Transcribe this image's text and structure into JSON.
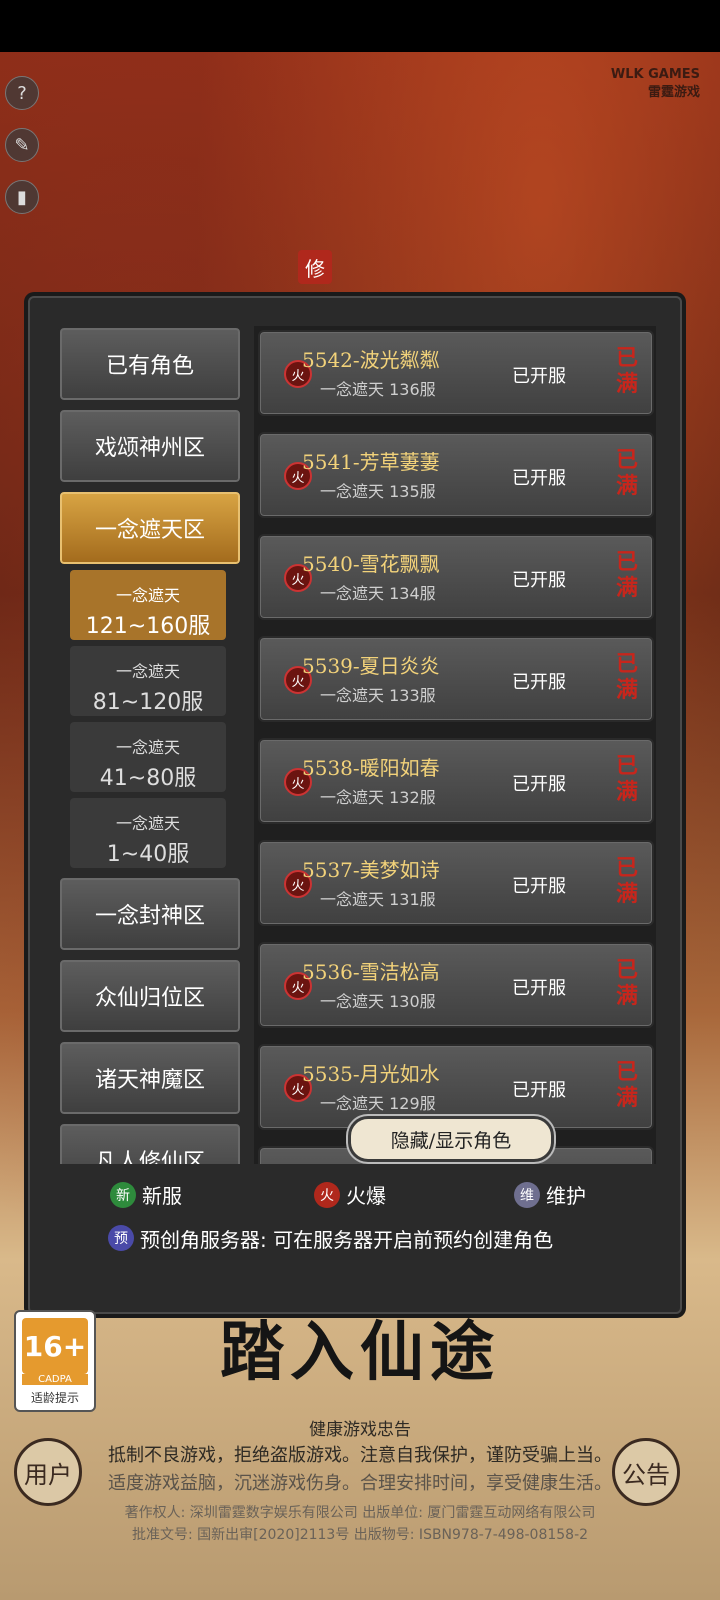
{
  "brand": {
    "line1": "WLK GAMES",
    "line2": "雷霆游戏"
  },
  "seal_char": "修",
  "side_icons": [
    "help-icon",
    "wrench-icon",
    "signal-icon"
  ],
  "categories": [
    {
      "label": "已有角色"
    },
    {
      "label": "戏颂神州区"
    },
    {
      "label": "一念遮天区"
    },
    {
      "label": "一念封神区"
    },
    {
      "label": "众仙归位区"
    },
    {
      "label": "诸天神魔区"
    },
    {
      "label": "凡人修仙区"
    }
  ],
  "subcategories": [
    {
      "line1": "一念遮天",
      "line2": "121~160服"
    },
    {
      "line1": "一念遮天",
      "line2": "81~120服"
    },
    {
      "line1": "一念遮天",
      "line2": "41~80服"
    },
    {
      "line1": "一念遮天",
      "line2": "1~40服"
    }
  ],
  "servers": [
    {
      "badge": "火",
      "name": "5542-波光粼粼",
      "sub": "一念遮天 136服",
      "status": "已开服",
      "full": "已满"
    },
    {
      "badge": "火",
      "name": "5541-芳草萋萋",
      "sub": "一念遮天 135服",
      "status": "已开服",
      "full": "已满"
    },
    {
      "badge": "火",
      "name": "5540-雪花飘飘",
      "sub": "一念遮天 134服",
      "status": "已开服",
      "full": "已满"
    },
    {
      "badge": "火",
      "name": "5539-夏日炎炎",
      "sub": "一念遮天 133服",
      "status": "已开服",
      "full": "已满"
    },
    {
      "badge": "火",
      "name": "5538-暖阳如春",
      "sub": "一念遮天 132服",
      "status": "已开服",
      "full": "已满"
    },
    {
      "badge": "火",
      "name": "5537-美梦如诗",
      "sub": "一念遮天 131服",
      "status": "已开服",
      "full": "已满"
    },
    {
      "badge": "火",
      "name": "5536-雪洁松高",
      "sub": "一念遮天 130服",
      "status": "已开服",
      "full": "已满"
    },
    {
      "badge": "火",
      "name": "5535-月光如水",
      "sub": "一念遮天 129服",
      "status": "已开服",
      "full": "已满"
    }
  ],
  "toggle_label": "隐藏/显示角色",
  "legend": {
    "new": {
      "badge": "新",
      "label": "新服",
      "color": "#2e8b3c"
    },
    "hot": {
      "badge": "火",
      "label": "火爆",
      "color": "#b0281c"
    },
    "maint": {
      "badge": "维",
      "label": "维护",
      "color": "#6f6f8f"
    }
  },
  "pre_create": {
    "badge": "预",
    "text": "预创角服务器: 可在服务器开启前预约创建角色"
  },
  "age_rating": {
    "value": "16+",
    "org": "CADPA",
    "tip": "适龄提示"
  },
  "slogan": "踏入仙途",
  "left_round": "用户",
  "right_round": "公告",
  "health": {
    "title": "健康游戏忠告",
    "line1": "抵制不良游戏，拒绝盗版游戏。注意自我保护，谨防受骗上当。",
    "line2": "适度游戏益脑，沉迷游戏伤身。合理安排时间，享受健康生活。",
    "copyright": "著作权人: 深圳雷霆数字娱乐有限公司 出版单位: 厦门雷霆互动网络有限公司",
    "approval": "批准文号: 国新出审[2020]2113号 出版物号: ISBN978-7-498-08158-2"
  }
}
